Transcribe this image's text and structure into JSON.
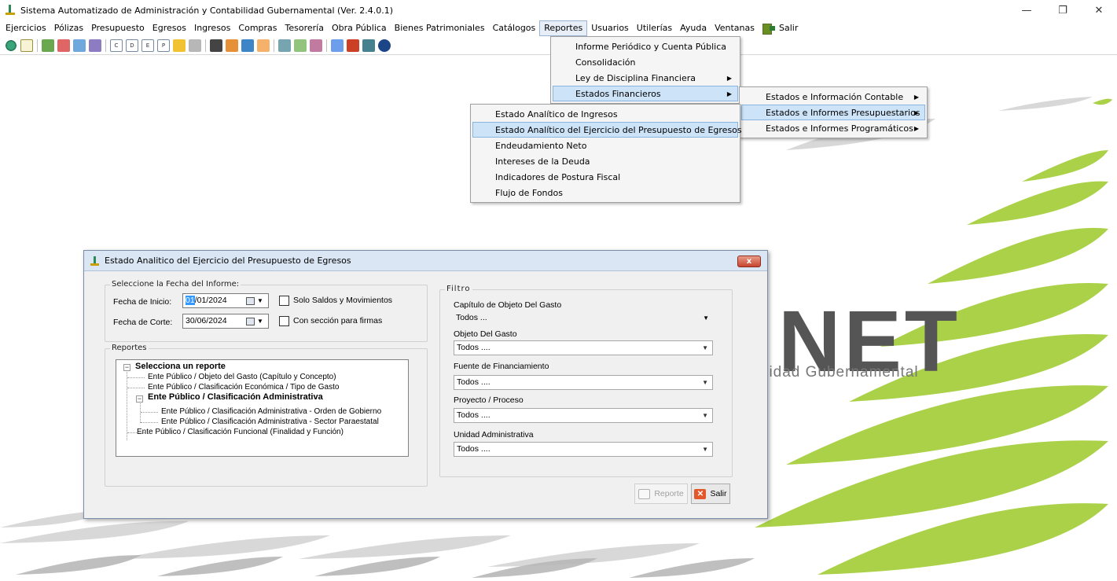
{
  "window": {
    "title": "Sistema Automatizado de Administración y Contabilidad Gubernamental  (Ver. 2.4.0.1)",
    "minimize": "—",
    "maximize": "❐",
    "close": "✕"
  },
  "menubar": {
    "items": [
      "Ejercicios",
      "Pólizas",
      "Presupuesto",
      "Egresos",
      "Ingresos",
      "Compras",
      "Tesorería",
      "Obra Pública",
      "Bienes Patrimoniales",
      "Catálogos",
      "Reportes",
      "Usuarios",
      "Utilerías",
      "Ayuda",
      "Ventanas"
    ],
    "active": "Reportes",
    "salir_label": "Salir"
  },
  "toolbar": {
    "letter_icons": [
      "C",
      "D",
      "E",
      "P"
    ]
  },
  "reportes_menu": {
    "items": [
      {
        "label": "Informe Periódico y Cuenta Pública",
        "submenu": false
      },
      {
        "label": "Consolidación",
        "submenu": false
      },
      {
        "label": "Ley de Disciplina Financiera",
        "submenu": true
      },
      {
        "label": "Estados Financieros",
        "submenu": true,
        "highlighted": true
      }
    ]
  },
  "estados_financieros_menu": {
    "items": [
      {
        "label": "Estados e Información Contable",
        "submenu": true
      },
      {
        "label": "Estados e Informes Presupuestarios",
        "submenu": true,
        "highlighted": true
      },
      {
        "label": "Estados e Informes Programáticos",
        "submenu": true
      }
    ]
  },
  "presupuestarios_menu": {
    "items": [
      {
        "label": "Estado Analítico de Ingresos"
      },
      {
        "label": "Estado Analítico del Ejercicio del Presupuesto de Egresos",
        "highlighted": true
      },
      {
        "label": "Endeudamiento Neto"
      },
      {
        "label": "Intereses de la Deuda"
      },
      {
        "label": "Indicadores de Postura Fiscal"
      },
      {
        "label": "Flujo de Fondos"
      }
    ]
  },
  "background_logo": {
    "brand": "NET",
    "subtitle": "ilidad Gubernamental"
  },
  "dialog": {
    "title": "Estado Analitico del Ejercicio del Presupuesto de Egresos",
    "close_label": "x",
    "fecha_group": "Seleccione la Fecha del Informe:",
    "fecha_inicio_label": "Fecha de Inicio:",
    "fecha_inicio_selected": "01",
    "fecha_inicio_rest": "/01/2024",
    "fecha_corte_label": "Fecha de Corte:",
    "fecha_corte_value": "30/06/2024",
    "check_saldos": "Solo Saldos y Movimientos",
    "check_firmas": "Con sección para firmas",
    "reportes_group": "Reportes",
    "tree": {
      "root": "Selecciona un reporte",
      "items": [
        "Ente Público / Objeto del Gasto (Capítulo y Concepto)",
        "Ente Público / Clasificación Económica / Tipo de Gasto",
        "Ente Público / Clasificación Administrativa",
        "Ente Público / Clasificación Administrativa - Orden de Gobierno",
        "Ente Público / Clasificación Administrativa - Sector Paraestatal",
        "Ente Público / Clasificación Funcional (Finalidad y Función)"
      ]
    },
    "filtro_group": "Filtro",
    "filters": [
      {
        "label": "Capítulo de Objeto Del Gasto",
        "value": "Todos ..."
      },
      {
        "label": "Objeto Del Gasto",
        "value": "Todos ...."
      },
      {
        "label": "Fuente de Financiamiento",
        "value": "Todos ...."
      },
      {
        "label": "Proyecto / Proceso",
        "value": "Todos ...."
      },
      {
        "label": "Unidad Administrativa",
        "value": "Todos ...."
      }
    ],
    "btn_reporte": "Reporte",
    "btn_salir": "Salir"
  },
  "colors": {
    "menu_highlight": "#cde3f7",
    "menu_highlight_border": "#88b4e0",
    "dialog_bg": "#f0f0f0",
    "swoosh": "#9ac43c"
  }
}
